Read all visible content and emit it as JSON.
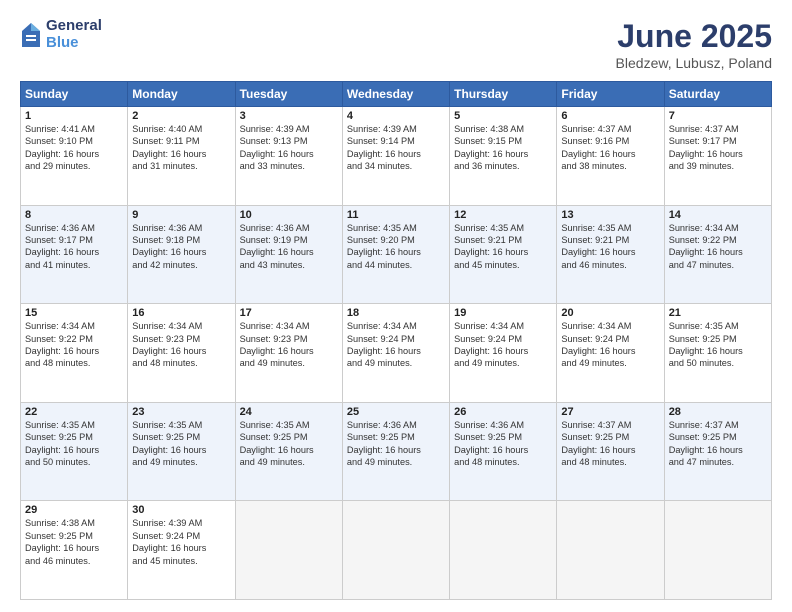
{
  "header": {
    "logo_general": "General",
    "logo_blue": "Blue",
    "title": "June 2025",
    "subtitle": "Bledzew, Lubusz, Poland"
  },
  "days_of_week": [
    "Sunday",
    "Monday",
    "Tuesday",
    "Wednesday",
    "Thursday",
    "Friday",
    "Saturday"
  ],
  "weeks": [
    [
      {
        "day": "1",
        "lines": [
          "Sunrise: 4:41 AM",
          "Sunset: 9:10 PM",
          "Daylight: 16 hours",
          "and 29 minutes."
        ]
      },
      {
        "day": "2",
        "lines": [
          "Sunrise: 4:40 AM",
          "Sunset: 9:11 PM",
          "Daylight: 16 hours",
          "and 31 minutes."
        ]
      },
      {
        "day": "3",
        "lines": [
          "Sunrise: 4:39 AM",
          "Sunset: 9:13 PM",
          "Daylight: 16 hours",
          "and 33 minutes."
        ]
      },
      {
        "day": "4",
        "lines": [
          "Sunrise: 4:39 AM",
          "Sunset: 9:14 PM",
          "Daylight: 16 hours",
          "and 34 minutes."
        ]
      },
      {
        "day": "5",
        "lines": [
          "Sunrise: 4:38 AM",
          "Sunset: 9:15 PM",
          "Daylight: 16 hours",
          "and 36 minutes."
        ]
      },
      {
        "day": "6",
        "lines": [
          "Sunrise: 4:37 AM",
          "Sunset: 9:16 PM",
          "Daylight: 16 hours",
          "and 38 minutes."
        ]
      },
      {
        "day": "7",
        "lines": [
          "Sunrise: 4:37 AM",
          "Sunset: 9:17 PM",
          "Daylight: 16 hours",
          "and 39 minutes."
        ]
      }
    ],
    [
      {
        "day": "8",
        "lines": [
          "Sunrise: 4:36 AM",
          "Sunset: 9:17 PM",
          "Daylight: 16 hours",
          "and 41 minutes."
        ]
      },
      {
        "day": "9",
        "lines": [
          "Sunrise: 4:36 AM",
          "Sunset: 9:18 PM",
          "Daylight: 16 hours",
          "and 42 minutes."
        ]
      },
      {
        "day": "10",
        "lines": [
          "Sunrise: 4:36 AM",
          "Sunset: 9:19 PM",
          "Daylight: 16 hours",
          "and 43 minutes."
        ]
      },
      {
        "day": "11",
        "lines": [
          "Sunrise: 4:35 AM",
          "Sunset: 9:20 PM",
          "Daylight: 16 hours",
          "and 44 minutes."
        ]
      },
      {
        "day": "12",
        "lines": [
          "Sunrise: 4:35 AM",
          "Sunset: 9:21 PM",
          "Daylight: 16 hours",
          "and 45 minutes."
        ]
      },
      {
        "day": "13",
        "lines": [
          "Sunrise: 4:35 AM",
          "Sunset: 9:21 PM",
          "Daylight: 16 hours",
          "and 46 minutes."
        ]
      },
      {
        "day": "14",
        "lines": [
          "Sunrise: 4:34 AM",
          "Sunset: 9:22 PM",
          "Daylight: 16 hours",
          "and 47 minutes."
        ]
      }
    ],
    [
      {
        "day": "15",
        "lines": [
          "Sunrise: 4:34 AM",
          "Sunset: 9:22 PM",
          "Daylight: 16 hours",
          "and 48 minutes."
        ]
      },
      {
        "day": "16",
        "lines": [
          "Sunrise: 4:34 AM",
          "Sunset: 9:23 PM",
          "Daylight: 16 hours",
          "and 48 minutes."
        ]
      },
      {
        "day": "17",
        "lines": [
          "Sunrise: 4:34 AM",
          "Sunset: 9:23 PM",
          "Daylight: 16 hours",
          "and 49 minutes."
        ]
      },
      {
        "day": "18",
        "lines": [
          "Sunrise: 4:34 AM",
          "Sunset: 9:24 PM",
          "Daylight: 16 hours",
          "and 49 minutes."
        ]
      },
      {
        "day": "19",
        "lines": [
          "Sunrise: 4:34 AM",
          "Sunset: 9:24 PM",
          "Daylight: 16 hours",
          "and 49 minutes."
        ]
      },
      {
        "day": "20",
        "lines": [
          "Sunrise: 4:34 AM",
          "Sunset: 9:24 PM",
          "Daylight: 16 hours",
          "and 49 minutes."
        ]
      },
      {
        "day": "21",
        "lines": [
          "Sunrise: 4:35 AM",
          "Sunset: 9:25 PM",
          "Daylight: 16 hours",
          "and 50 minutes."
        ]
      }
    ],
    [
      {
        "day": "22",
        "lines": [
          "Sunrise: 4:35 AM",
          "Sunset: 9:25 PM",
          "Daylight: 16 hours",
          "and 50 minutes."
        ]
      },
      {
        "day": "23",
        "lines": [
          "Sunrise: 4:35 AM",
          "Sunset: 9:25 PM",
          "Daylight: 16 hours",
          "and 49 minutes."
        ]
      },
      {
        "day": "24",
        "lines": [
          "Sunrise: 4:35 AM",
          "Sunset: 9:25 PM",
          "Daylight: 16 hours",
          "and 49 minutes."
        ]
      },
      {
        "day": "25",
        "lines": [
          "Sunrise: 4:36 AM",
          "Sunset: 9:25 PM",
          "Daylight: 16 hours",
          "and 49 minutes."
        ]
      },
      {
        "day": "26",
        "lines": [
          "Sunrise: 4:36 AM",
          "Sunset: 9:25 PM",
          "Daylight: 16 hours",
          "and 48 minutes."
        ]
      },
      {
        "day": "27",
        "lines": [
          "Sunrise: 4:37 AM",
          "Sunset: 9:25 PM",
          "Daylight: 16 hours",
          "and 48 minutes."
        ]
      },
      {
        "day": "28",
        "lines": [
          "Sunrise: 4:37 AM",
          "Sunset: 9:25 PM",
          "Daylight: 16 hours",
          "and 47 minutes."
        ]
      }
    ],
    [
      {
        "day": "29",
        "lines": [
          "Sunrise: 4:38 AM",
          "Sunset: 9:25 PM",
          "Daylight: 16 hours",
          "and 46 minutes."
        ]
      },
      {
        "day": "30",
        "lines": [
          "Sunrise: 4:39 AM",
          "Sunset: 9:24 PM",
          "Daylight: 16 hours",
          "and 45 minutes."
        ]
      },
      {
        "day": "",
        "lines": []
      },
      {
        "day": "",
        "lines": []
      },
      {
        "day": "",
        "lines": []
      },
      {
        "day": "",
        "lines": []
      },
      {
        "day": "",
        "lines": []
      }
    ]
  ]
}
